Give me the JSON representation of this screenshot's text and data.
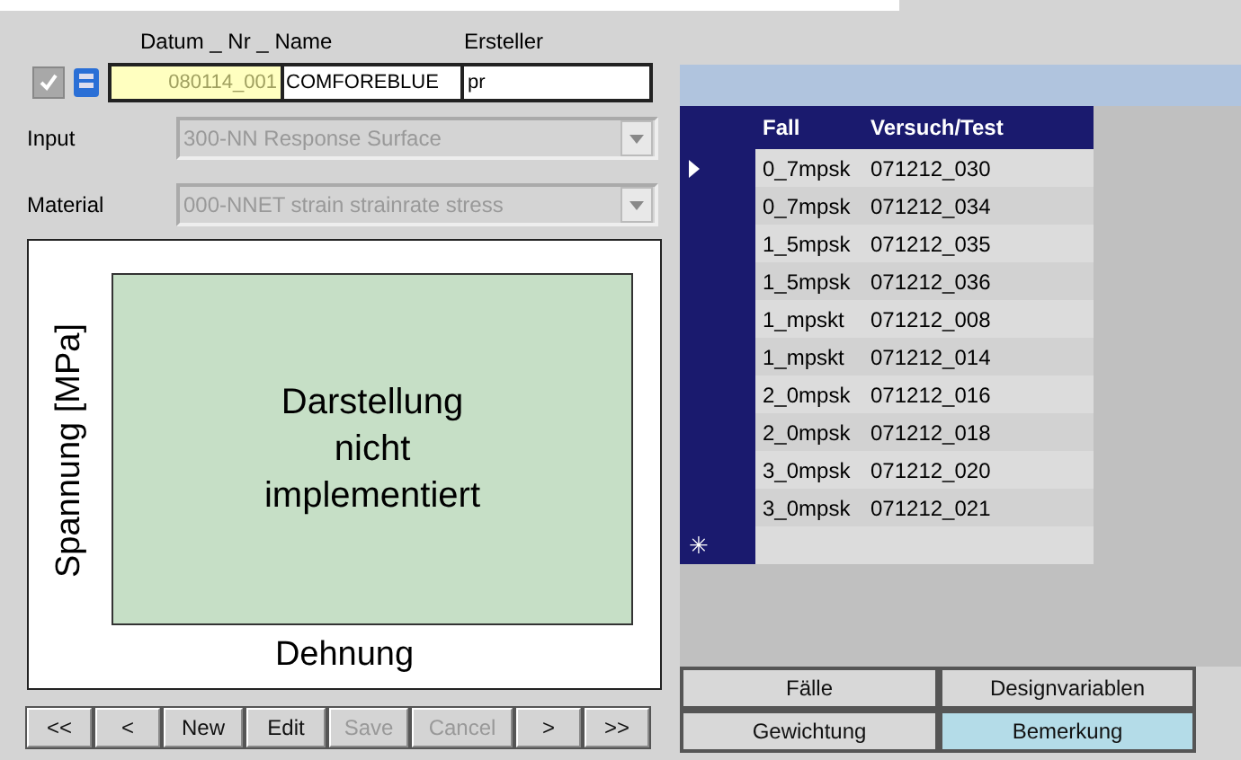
{
  "header": {
    "labels": [
      {
        "text": "Datum _ Nr _ Name"
      },
      {
        "text": "Ersteller"
      }
    ],
    "checked": true,
    "date_nr": "080114_001",
    "name": "COMFOREBLUE",
    "ersteller": "pr"
  },
  "input": {
    "label": "Input",
    "value": "300-NN Response Surface",
    "disabled": true
  },
  "material": {
    "label": "Material",
    "value": "000-NNET strain strainrate stress",
    "disabled": true
  },
  "plot": {
    "ylabel": "Spannung [MPa]",
    "xlabel": "Dehnung",
    "message": "Darstellung nicht implementiert"
  },
  "nav_buttons": [
    {
      "label": "<<",
      "disabled": false
    },
    {
      "label": "<",
      "disabled": false
    },
    {
      "label": "New",
      "disabled": false
    },
    {
      "label": "Edit",
      "disabled": false
    },
    {
      "label": "Save",
      "disabled": true
    },
    {
      "label": "Cancel",
      "disabled": true
    },
    {
      "label": ">",
      "disabled": false
    },
    {
      "label": ">>",
      "disabled": false
    }
  ],
  "table": {
    "columns": [
      "Fall",
      "Versuch/Test"
    ],
    "rows": [
      {
        "fall": "0_7mpsk",
        "test": "071212_030",
        "current": true
      },
      {
        "fall": "0_7mpsk",
        "test": "071212_034",
        "current": false
      },
      {
        "fall": "1_5mpsk",
        "test": "071212_035",
        "current": false
      },
      {
        "fall": "1_5mpsk",
        "test": "071212_036",
        "current": false
      },
      {
        "fall": "1_mpskt",
        "test": "071212_008",
        "current": false
      },
      {
        "fall": "1_mpskt",
        "test": "071212_014",
        "current": false
      },
      {
        "fall": "2_0mpsk",
        "test": "071212_016",
        "current": false
      },
      {
        "fall": "2_0mpsk",
        "test": "071212_018",
        "current": false
      },
      {
        "fall": "3_0mpsk",
        "test": "071212_020",
        "current": false
      },
      {
        "fall": "3_0mpsk",
        "test": "071212_021",
        "current": false
      }
    ],
    "new_row_marker": "✳"
  },
  "tabs": [
    {
      "label": "Fälle",
      "selected": false
    },
    {
      "label": "Designvariablen",
      "selected": false
    },
    {
      "label": "Gewichtung",
      "selected": false
    },
    {
      "label": "Bemerkung",
      "selected": true
    }
  ]
}
